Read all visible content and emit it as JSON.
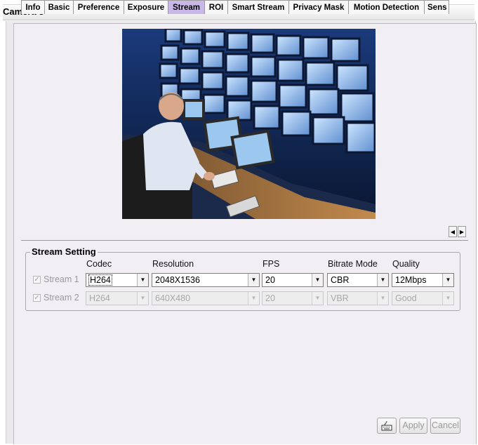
{
  "window": {
    "title": "Camera 3"
  },
  "tabs": [
    {
      "label": "Info",
      "active": false
    },
    {
      "label": "Basic",
      "active": false
    },
    {
      "label": "Preference",
      "active": false
    },
    {
      "label": "Exposure",
      "active": false
    },
    {
      "label": "Stream",
      "active": true
    },
    {
      "label": "ROI",
      "active": false
    },
    {
      "label": "Smart Stream",
      "active": false
    },
    {
      "label": "Privacy Mask",
      "active": false
    },
    {
      "label": "Motion Detection",
      "active": false
    },
    {
      "label": "Sens",
      "active": false
    }
  ],
  "tab_scroll": {
    "left_icon": "chevron-left-icon",
    "right_icon": "chevron-right-icon"
  },
  "stream_setting": {
    "title": "Stream Setting",
    "columns": {
      "codec": "Codec",
      "resolution": "Resolution",
      "fps": "FPS",
      "bitrate_mode": "Bitrate Mode",
      "quality": "Quality"
    },
    "streams": [
      {
        "label": "Stream 1",
        "checked": true,
        "enabled": true,
        "codec": "H264",
        "resolution": "2048X1536",
        "fps": "20",
        "bitrate_mode": "CBR",
        "quality": "12Mbps"
      },
      {
        "label": "Stream 2",
        "checked": true,
        "enabled": false,
        "codec": "H264",
        "resolution": "640X480",
        "fps": "20",
        "bitrate_mode": "VBR",
        "quality": "Good"
      }
    ]
  },
  "buttons": {
    "keyboard_icon": "keyboard-icon",
    "apply": "Apply",
    "cancel": "Cancel"
  },
  "colors": {
    "active_tab": "#c9b7e8",
    "panel_bg": "#f2eff4",
    "disabled_text": "#a8a8a8"
  }
}
